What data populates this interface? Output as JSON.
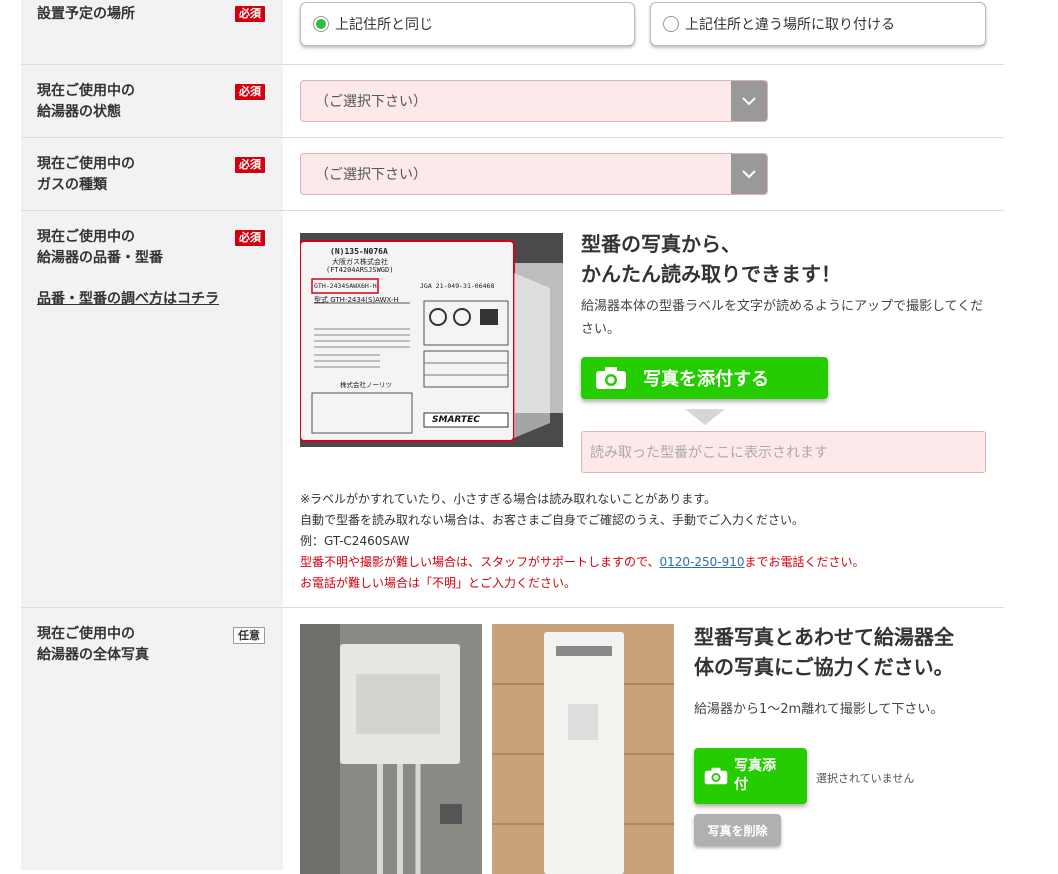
{
  "rows": {
    "location": {
      "label": "設置予定の場所",
      "badge": "必須",
      "options": [
        "上記住所と同じ",
        "上記住所と違う場所に取り付ける"
      ],
      "selected_index": 0
    },
    "heater_state": {
      "label_line1": "現在ご使用中の",
      "label_line2": "給湯器の状態",
      "badge": "必須",
      "select_value": "（ご選択下さい）"
    },
    "gas_type": {
      "label_line1": "現在ご使用中の",
      "label_line2": "ガスの種類",
      "badge": "必須",
      "select_value": "（ご選択下さい）"
    },
    "model": {
      "label_line1": "現在ご使用中の",
      "label_line2": "給湯器の品番・型番",
      "badge": "必須",
      "help_link": "品番・型番の調べ方はコチラ",
      "heading_line1": "型番の写真から、",
      "heading_line2": "かんたん読み取りできます！",
      "description": "給湯器本体の型番ラベルを文字が読めるようにアップで撮影してください。",
      "attach_button": "写真を添付する",
      "result_placeholder": "読み取った型番がここに表示されます",
      "note1": "※ラベルがかすれていたり、小さすぎる場合は読み取れないことがあります。",
      "note2": "自動で型番を読み取れない場合は、お客さまご自身でご確認のうえ、手動でご入力ください。",
      "note3": "例：GT-C2460SAW",
      "note4_prefix": "型番不明や撮影が難しい場合は、スタッフがサポートしますので、",
      "phone": "0120-250-910",
      "note4_suffix": "までお電話ください。",
      "note5": "お電話が難しい場合は「不明」とご入力ください。",
      "label_image": {
        "code_top": "(N)135-N076A",
        "maker_top": "大阪ガス株式会社",
        "code_sub": "(FT4204ARSJSWGD)",
        "model_highlight": "GTH-2434SAWX6H-H",
        "jga": "JGA 21-049-31-06468",
        "model_line": "型式 GTH-2434(S)AWX-H",
        "maker_bottom": "株式会社ノーリツ",
        "brand": "SMARTEC"
      }
    },
    "photo": {
      "label_line1": "現在ご使用中の",
      "label_line2": "給湯器の全体写真",
      "badge": "任意",
      "heading_line1": "型番写真とあわせて給湯器全",
      "heading_line2": "体の写真にご協力ください。",
      "description": "給湯器から1〜2m離れて撮影して下さい。",
      "attach_button_line1": "写真添",
      "attach_button_line2": "付",
      "no_file": "選択されていません",
      "delete_button": "写真を削除"
    }
  },
  "colors": {
    "required_badge": "#d4000f",
    "green_button": "#25cc00",
    "select_bg": "#fde8ea",
    "label_bg": "#f2f2f2"
  }
}
